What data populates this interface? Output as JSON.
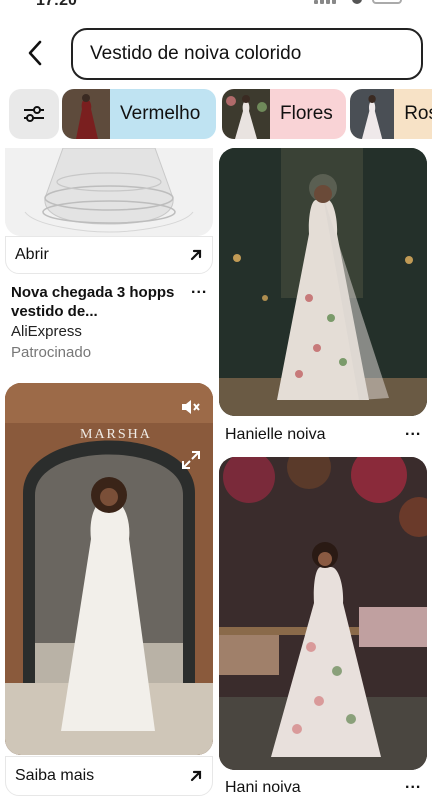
{
  "status_bar": {
    "time": "17:20"
  },
  "search": {
    "query": "Vestido de noiva colorido"
  },
  "chips": [
    {
      "label": "Vermelho"
    },
    {
      "label": "Flores"
    },
    {
      "label": "Ros"
    }
  ],
  "pins": {
    "ad": {
      "cta": "Abrir",
      "title": "Nova chegada 3 hopps vestido de...",
      "source": "AliExpress",
      "sponsored": "Patrocinado"
    },
    "bride1": {
      "caption": "Hanielle noiva"
    },
    "marsha": {
      "brand": "MARSHA",
      "cta": "Saiba mais"
    },
    "bride2": {
      "caption": "Hani noiva"
    }
  },
  "more_menu": "..."
}
